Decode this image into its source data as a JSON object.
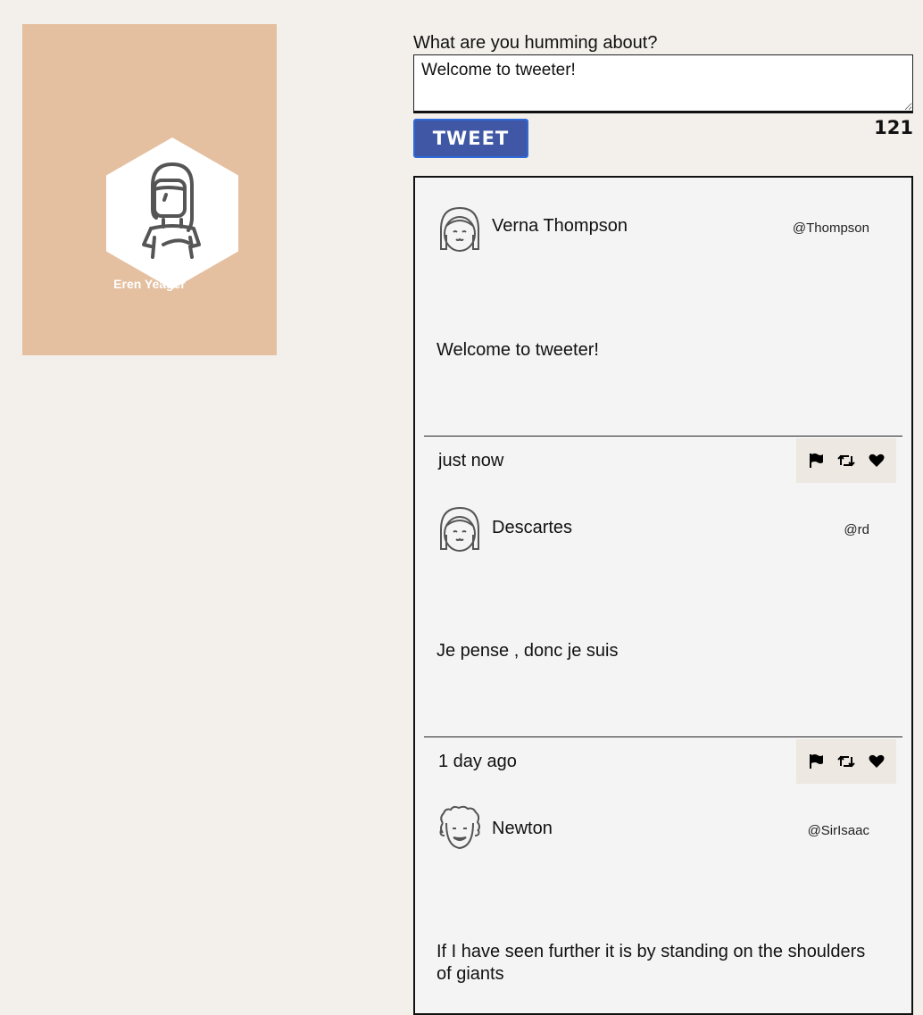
{
  "profile": {
    "name": "Eren Yeager",
    "card_color": "#e4c0a1"
  },
  "compose": {
    "label": "What are you humming about?",
    "value": "Welcome to tweeter!",
    "button_label": "TWEET",
    "char_counter": "121",
    "button_color": "#3f57a4"
  },
  "tweets": [
    {
      "name": "Verna Thompson",
      "handle": "@Thompson",
      "text": "Welcome to tweeter!",
      "time": "just now",
      "avatar": "girl-avatar-icon"
    },
    {
      "name": "Descartes",
      "handle": "@rd",
      "text": "Je pense , donc je suis",
      "time": "1 day ago",
      "avatar": "girl-avatar-icon"
    },
    {
      "name": "Newton",
      "handle": "@SirIsaac",
      "text": "If I have seen further it is by standing on the shoulders of giants",
      "avatar": "curly-hair-avatar-icon"
    }
  ],
  "icons": {
    "flag": "flag-icon",
    "retweet": "retweet-icon",
    "like": "heart-icon"
  }
}
